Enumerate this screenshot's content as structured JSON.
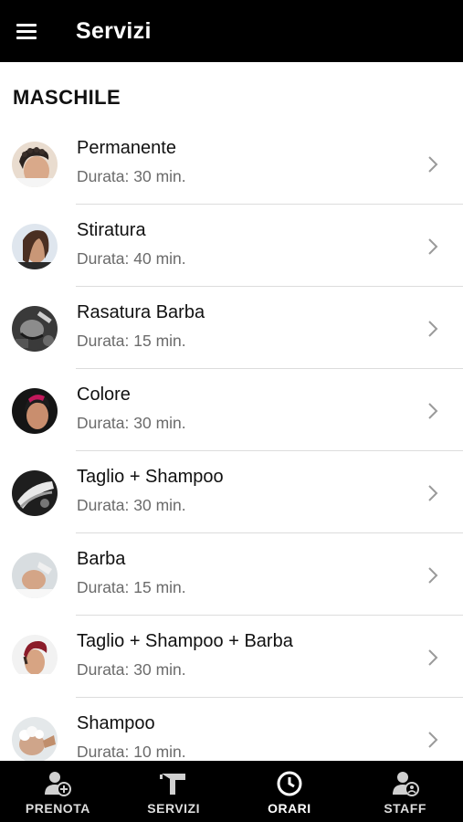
{
  "appbar": {
    "title": "Servizi",
    "menu_icon": "hamburger-menu-icon"
  },
  "section": {
    "title": "MASCHILE"
  },
  "services": [
    {
      "name": "Permanente",
      "duration": "Durata: 30 min.",
      "avatar": "curly-hair-photo"
    },
    {
      "name": "Stiratura",
      "duration": "Durata: 40 min.",
      "avatar": "long-straight-hair-photo"
    },
    {
      "name": "Rasatura Barba",
      "duration": "Durata: 15 min.",
      "avatar": "beard-shave-photo"
    },
    {
      "name": "Colore",
      "duration": "Durata: 30 min.",
      "avatar": "colored-hair-photo"
    },
    {
      "name": "Taglio + Shampoo",
      "duration": "Durata: 30 min.",
      "avatar": "haircut-shampoo-photo"
    },
    {
      "name": "Barba",
      "duration": "Durata: 15 min.",
      "avatar": "beard-trim-photo"
    },
    {
      "name": "Taglio + Shampoo + Barba",
      "duration": "Durata: 30 min.",
      "avatar": "fade-haircut-photo"
    },
    {
      "name": "Shampoo",
      "duration": "Durata: 10 min.",
      "avatar": "hair-wash-photo"
    }
  ],
  "bottom_nav": [
    {
      "label": "PRENOTA",
      "icon": "person-add-icon"
    },
    {
      "label": "SERVIZI",
      "icon": "hair-dryer-icon"
    },
    {
      "label": "ORARI",
      "icon": "clock-icon",
      "active": true
    },
    {
      "label": "STAFF",
      "icon": "person-badge-icon"
    }
  ],
  "colors": {
    "bar_background": "#000000",
    "secondary_text": "#6b6b6b",
    "divider": "#dcdcdc"
  }
}
